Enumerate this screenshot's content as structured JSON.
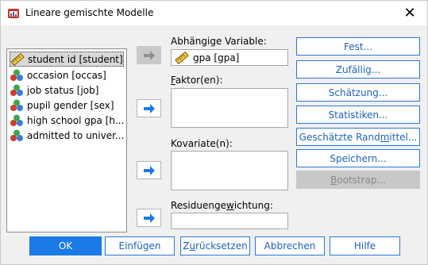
{
  "window": {
    "title": "Lineare gemischte Modelle",
    "close_glyph": "✕"
  },
  "variables": [
    {
      "label": "student id [student]",
      "icon": "ruler-scale-icon",
      "selected": true
    },
    {
      "label": "occasion [occas]",
      "icon": "nominal-icon",
      "selected": false
    },
    {
      "label": "job status [job]",
      "icon": "nominal-icon",
      "selected": false
    },
    {
      "label": "pupil gender [sex]",
      "icon": "nominal-icon",
      "selected": false
    },
    {
      "label": "high school gpa [h...",
      "icon": "nominal-icon",
      "selected": false
    },
    {
      "label": "admitted to univer...",
      "icon": "nominal-icon",
      "selected": false
    }
  ],
  "fields": {
    "dependent_label": "Abhängige Variable:",
    "dependent_value": "gpa [gpa]",
    "factors_label_pre": "",
    "factors_label_ul": "F",
    "factors_label_post": "aktor(en):",
    "covariates_label": "Kovariate(n):",
    "residual_label_pre": "Residuenge",
    "residual_label_ul": "w",
    "residual_label_post": "ichtung:"
  },
  "side_buttons": [
    {
      "pre": "Fest...",
      "ul": "",
      "post": "",
      "disabled": false
    },
    {
      "pre": "Zufällig...",
      "ul": "",
      "post": "",
      "disabled": false
    },
    {
      "pre": "Schätzung...",
      "ul": "",
      "post": "",
      "disabled": false
    },
    {
      "pre": "Statistiken...",
      "ul": "",
      "post": "",
      "disabled": false
    },
    {
      "pre": "Geschätzte Rand",
      "ul": "m",
      "post": "ittel...",
      "disabled": false
    },
    {
      "pre": "Speichern...",
      "ul": "",
      "post": "",
      "disabled": false
    },
    {
      "pre": "",
      "ul": "B",
      "post": "ootstrap...",
      "disabled": true
    }
  ],
  "bottom_buttons": {
    "ok": "OK",
    "paste": "Einfügen",
    "reset_pre": "Z",
    "reset_ul": "u",
    "reset_post": "rücksetzen",
    "cancel": "Abbrechen",
    "help": "Hilfe"
  },
  "colors": {
    "accent": "#1a7ae6",
    "button_text": "#1c62c4",
    "disabled": "#c8c8c8"
  }
}
